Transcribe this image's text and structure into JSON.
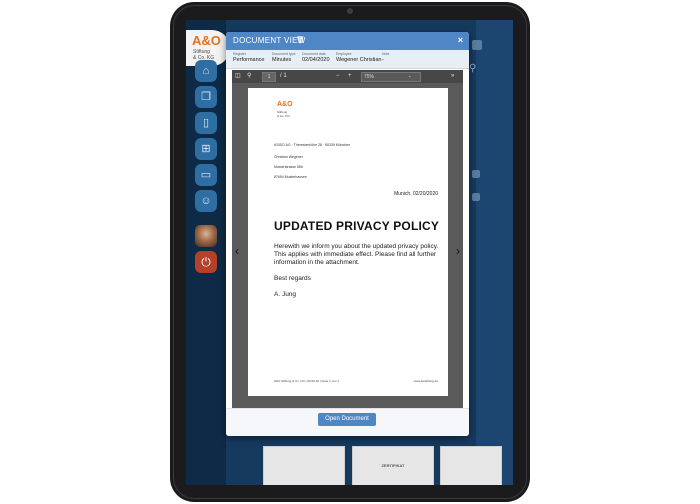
{
  "sidebar": {
    "logo_main": "A&O",
    "logo_sub1": "Stiftung",
    "logo_sub2": "& Co. KG",
    "icons": [
      "home-icon",
      "copy-icon",
      "document-icon",
      "add-document-icon",
      "folder-icon",
      "user-icon"
    ]
  },
  "modal": {
    "title": "DOCUMENT VIEW",
    "meta": [
      {
        "label": "Register",
        "value": "Performance"
      },
      {
        "label": "Document type",
        "value": "Minutes"
      },
      {
        "label": "Document date",
        "value": "02/04/2020"
      },
      {
        "label": "Employee",
        "value": "Wegener Christian"
      },
      {
        "label": "Note",
        "value": "-"
      }
    ],
    "toolbar": {
      "page": "1",
      "page_total": "/ 1",
      "zoom": "75%"
    },
    "open_button": "Open Document"
  },
  "document": {
    "logo_main": "A&O",
    "logo_sub1": "Stiftung",
    "logo_sub2": "& Co. KG",
    "sender_line": "ASIDO AG · Theresienhöhe 28 · 80339 München",
    "address": [
      "Christian Wegener",
      "Musterstrasse 85b",
      "87654 Musterhausen"
    ],
    "date": "Munich, 02/20/2020",
    "title": "UPDATED PRIVACY POLICY",
    "body": "Herewith we inform you about the updated privacy policy. This applies with immediate effect. Please find all further information in the attachment.",
    "regards": "Best regards",
    "signature": "A. Jung",
    "footer_left": "A&O Stiftung & Co. KG | 00.00.20 | Seite 1 von 1",
    "footer_right": "www.aostiftung.de"
  },
  "thumbnails": {
    "middle_title": "ZERTIFIKAT"
  }
}
